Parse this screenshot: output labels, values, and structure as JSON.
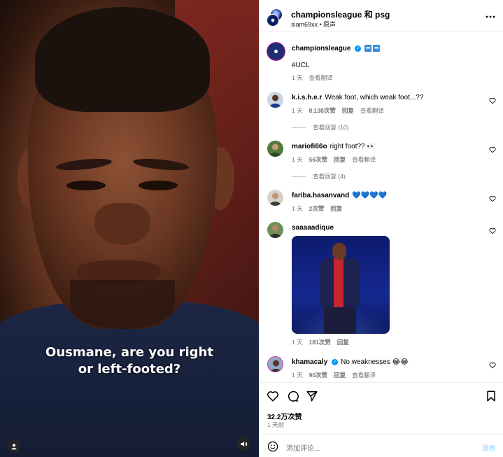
{
  "video": {
    "caption_line1": "Ousmane, are you right",
    "caption_line2": "or left-footed?",
    "user_icon": "user-icon",
    "sound_icon": "sound-icon"
  },
  "header": {
    "title": "championsleague 和 psg",
    "subtitle": "siam69xx • 原声",
    "more_icon": "more-horizontal-icon"
  },
  "caption": {
    "user": "championsleague",
    "hashtag": "#UCL",
    "time": "1 天",
    "translate": "查看翻译"
  },
  "comments": [
    {
      "user": "k.i.s.h.e.r",
      "text": "Weak foot, which weak foot...??",
      "time": "1 天",
      "likes": "8,138次赞",
      "reply": "回复",
      "translate": "查看翻译",
      "replies": "查看回复 (10)"
    },
    {
      "user": "mariofi66o",
      "text": "right foot?? 👀",
      "time": "1 天",
      "likes": "56次赞",
      "reply": "回复",
      "translate": "查看翻译",
      "replies": "查看回复 (4)"
    },
    {
      "user": "fariba.hasanvand",
      "text": "💙💙💙💙",
      "time": "1 天",
      "likes": "2次赞",
      "reply": "回复"
    },
    {
      "user": "saaaaadique",
      "text": "",
      "time": "1 天",
      "likes": "181次赞",
      "reply": "回复"
    },
    {
      "user": "khamacaly",
      "text": "No weaknesses 😂😂",
      "time": "1 天",
      "likes": "90次赞",
      "reply": "回复",
      "translate": "查看翻译"
    }
  ],
  "actions": {
    "likes": "32.2万次赞",
    "ago": "1 天前"
  },
  "add_comment": {
    "placeholder": "添加评论...",
    "post": "发布"
  },
  "colors": {
    "accent": "#0095f6",
    "hashtag": "#00376b",
    "muted": "#737373"
  }
}
